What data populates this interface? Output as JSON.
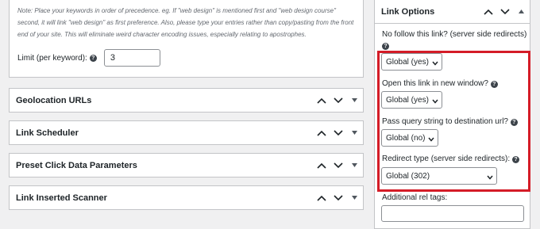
{
  "top_panel": {
    "note": "Note: Place your keywords in order of precedence. eg. If \"web design\" is mentioned first and \"web design course\" second, it will link \"web design\" as first preference. Also, please type your entries rather than copy/pasting from the front end of your site. This will eliminate weird character encoding issues, especially relating to apostrophes.",
    "limit_label": "Limit (per keyword):",
    "limit_value": "3"
  },
  "boxes": [
    {
      "title": "Geolocation URLs"
    },
    {
      "title": "Link Scheduler"
    },
    {
      "title": "Preset Click Data Parameters"
    },
    {
      "title": "Link Inserted Scanner"
    }
  ],
  "link_options": {
    "title": "Link Options",
    "nofollow_label": "No follow this link? (server side redirects)",
    "nofollow_value": "Global (yes)",
    "new_window_label": "Open this link in new window?",
    "new_window_value": "Global (yes)",
    "pass_query_label": "Pass query string to destination url?",
    "pass_query_value": "Global (no)",
    "redirect_label": "Redirect type (server side redirects):",
    "redirect_value": "Global (302)",
    "rel_tags_label": "Additional rel tags:",
    "rel_tags_value": ""
  },
  "colors": {
    "highlight": "#d41c27",
    "border": "#c3c4c7",
    "background": "#f0f0f1"
  },
  "icons": [
    "help-icon",
    "chevron-up-icon",
    "chevron-down-icon",
    "toggle-arrow-icon"
  ]
}
